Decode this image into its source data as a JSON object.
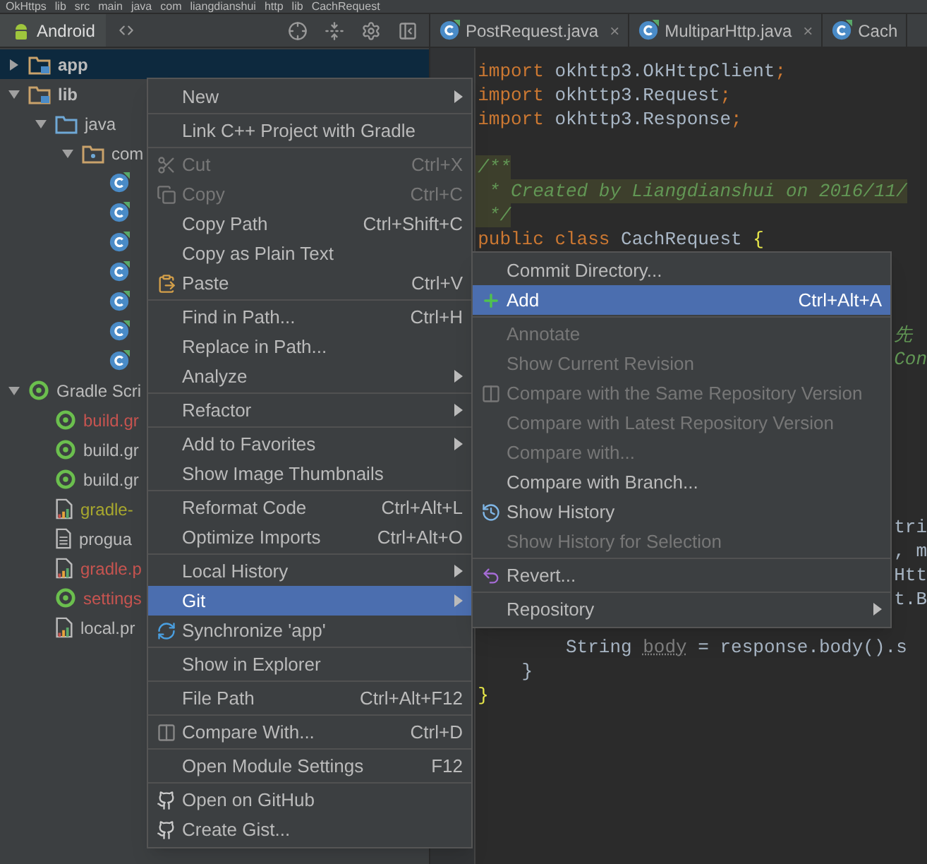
{
  "breadcrumb": [
    {
      "label": "OkHttps"
    },
    {
      "label": "lib"
    },
    {
      "label": "src"
    },
    {
      "label": "main"
    },
    {
      "label": "java"
    },
    {
      "label": "com"
    },
    {
      "label": "liangdianshui"
    },
    {
      "label": "http"
    },
    {
      "label": "lib"
    },
    {
      "label": "CachRequest"
    }
  ],
  "project_panel": {
    "view": "Android",
    "tree": [
      {
        "label": "app",
        "kind": "module",
        "bold": true,
        "selected": true,
        "expanded": false
      },
      {
        "label": "lib",
        "kind": "module",
        "bold": true,
        "selected": false,
        "expanded": true,
        "children": [
          {
            "label": "java",
            "kind": "source",
            "selected": false,
            "expanded": true,
            "children": [
              {
                "label": "com",
                "kind": "package",
                "selected": false,
                "expanded": true,
                "children": [
                  {
                    "kind": "class",
                    "selected": false
                  },
                  {
                    "kind": "class",
                    "selected": false
                  },
                  {
                    "kind": "class",
                    "selected": false
                  },
                  {
                    "kind": "class",
                    "selected": false
                  },
                  {
                    "kind": "class",
                    "selected": false
                  },
                  {
                    "kind": "class",
                    "selected": false
                  },
                  {
                    "kind": "class",
                    "selected": false
                  }
                ]
              }
            ]
          }
        ]
      },
      {
        "label": "Gradle Scri",
        "kind": "gradle",
        "selected": false,
        "expanded": true,
        "children": [
          {
            "label": "build.gr",
            "kind": "gradle",
            "color": "#c75450",
            "selected": false
          },
          {
            "label": "build.gr",
            "kind": "gradle",
            "color": "#bbbbbb",
            "selected": false
          },
          {
            "label": "build.gr",
            "kind": "gradle",
            "color": "#bbbbbb",
            "selected": false
          },
          {
            "label": "gradle-",
            "kind": "properties",
            "color": "#a8a82e",
            "selected": false
          },
          {
            "label": "progua",
            "kind": "text",
            "color": "#bbbbbb",
            "selected": false
          },
          {
            "label": "gradle.p",
            "kind": "properties",
            "color": "#c75450",
            "selected": false
          },
          {
            "label": "settings",
            "kind": "gradle",
            "color": "#c75450",
            "selected": false
          },
          {
            "label": "local.pr",
            "kind": "properties",
            "color": "#bbbbbb",
            "selected": false
          }
        ]
      }
    ]
  },
  "editor_tabs": [
    {
      "label": "PostRequest.java",
      "close": "×"
    },
    {
      "label": "MultiparHttp.java",
      "close": "×"
    },
    {
      "label": "Cach"
    }
  ],
  "code": [
    {
      "kind": "code",
      "segments": [
        {
          "text": "import",
          "kind": "keyword"
        },
        {
          "text": " okhttp3.OkHttpClient",
          "kind": "plain"
        },
        {
          "text": ";",
          "kind": "keyword"
        }
      ]
    },
    {
      "kind": "code",
      "segments": [
        {
          "text": "import",
          "kind": "keyword"
        },
        {
          "text": " okhttp3.Request",
          "kind": "plain"
        },
        {
          "text": ";",
          "kind": "keyword"
        }
      ]
    },
    {
      "kind": "code",
      "segments": [
        {
          "text": "import",
          "kind": "keyword"
        },
        {
          "text": " okhttp3.Response",
          "kind": "plain"
        },
        {
          "text": ";",
          "kind": "keyword"
        }
      ]
    },
    {
      "kind": "blank"
    },
    {
      "kind": "code",
      "doc": true,
      "segments": [
        {
          "text": "/**",
          "kind": "comment"
        }
      ]
    },
    {
      "kind": "code",
      "doc": true,
      "segments": [
        {
          "text": " * Created by Liangdianshui on 2016/11/",
          "kind": "comment"
        }
      ]
    },
    {
      "kind": "code",
      "doc": true,
      "segments": [
        {
          "text": " */",
          "kind": "comment"
        }
      ]
    },
    {
      "kind": "code",
      "segments": [
        {
          "text": "public class",
          "kind": "keyword"
        },
        {
          "text": " CachRequest ",
          "kind": "plain"
        },
        {
          "text": "{",
          "kind": "brace"
        }
      ]
    },
    {
      "kind": "blank"
    },
    {
      "kind": "blank"
    },
    {
      "kind": "blank"
    },
    {
      "kind": "fragment",
      "segments": [
        {
          "text": "先",
          "kind": "comment"
        }
      ]
    },
    {
      "kind": "fragment",
      "segments": [
        {
          "text": "Con",
          "kind": "comment"
        }
      ]
    },
    {
      "kind": "blank"
    },
    {
      "kind": "blank"
    },
    {
      "kind": "blank"
    },
    {
      "kind": "blank"
    },
    {
      "kind": "blank"
    },
    {
      "kind": "blank"
    },
    {
      "kind": "fragment",
      "segments": [
        {
          "text": "tri",
          "kind": "plain"
        }
      ]
    },
    {
      "kind": "fragment",
      "segments": [
        {
          "text": ", m",
          "kind": "plain"
        }
      ]
    },
    {
      "kind": "fragment",
      "segments": [
        {
          "text": "Htt",
          "kind": "plain"
        }
      ]
    },
    {
      "kind": "fragment",
      "segments": [
        {
          "text": "t.B",
          "kind": "plain"
        }
      ]
    },
    {
      "kind": "blank"
    },
    {
      "kind": "code",
      "segments": [
        {
          "text": "        String ",
          "kind": "plain"
        },
        {
          "text": "body",
          "kind": "unused"
        },
        {
          "text": " = response.body().s",
          "kind": "plain"
        }
      ]
    },
    {
      "kind": "code",
      "segments": [
        {
          "text": "    }",
          "kind": "plain"
        }
      ]
    },
    {
      "kind": "code",
      "segments": [
        {
          "text": "}",
          "kind": "brace"
        }
      ]
    }
  ],
  "context_menu": {
    "items": [
      {
        "kind": "item",
        "label": "New",
        "submenu": true,
        "disabled": false,
        "selected": false
      },
      {
        "kind": "separator"
      },
      {
        "kind": "item",
        "label": "Link C++ Project with Gradle",
        "disabled": false,
        "selected": false
      },
      {
        "kind": "separator"
      },
      {
        "kind": "item",
        "label": "Cut",
        "shortcut": "Ctrl+X",
        "disabled": true,
        "selected": false
      },
      {
        "kind": "item",
        "label": "Copy",
        "shortcut": "Ctrl+C",
        "disabled": true,
        "selected": false
      },
      {
        "kind": "item",
        "label": "Copy Path",
        "shortcut": "Ctrl+Shift+C",
        "disabled": false,
        "selected": false
      },
      {
        "kind": "item",
        "label": "Copy as Plain Text",
        "disabled": false,
        "selected": false
      },
      {
        "kind": "item",
        "label": "Paste",
        "shortcut": "Ctrl+V",
        "disabled": false,
        "selected": false
      },
      {
        "kind": "separator"
      },
      {
        "kind": "item",
        "label": "Find in Path...",
        "shortcut": "Ctrl+H",
        "disabled": false,
        "selected": false
      },
      {
        "kind": "item",
        "label": "Replace in Path...",
        "disabled": false,
        "selected": false
      },
      {
        "kind": "item",
        "label": "Analyze",
        "submenu": true,
        "disabled": false,
        "selected": false
      },
      {
        "kind": "separator"
      },
      {
        "kind": "item",
        "label": "Refactor",
        "submenu": true,
        "disabled": false,
        "selected": false
      },
      {
        "kind": "separator"
      },
      {
        "kind": "item",
        "label": "Add to Favorites",
        "submenu": true,
        "disabled": false,
        "selected": false
      },
      {
        "kind": "item",
        "label": "Show Image Thumbnails",
        "disabled": false,
        "selected": false
      },
      {
        "kind": "separator"
      },
      {
        "kind": "item",
        "label": "Reformat Code",
        "shortcut": "Ctrl+Alt+L",
        "disabled": false,
        "selected": false
      },
      {
        "kind": "item",
        "label": "Optimize Imports",
        "shortcut": "Ctrl+Alt+O",
        "disabled": false,
        "selected": false
      },
      {
        "kind": "separator"
      },
      {
        "kind": "item",
        "label": "Local History",
        "submenu": true,
        "disabled": false,
        "selected": false
      },
      {
        "kind": "item",
        "label": "Git",
        "submenu": true,
        "disabled": false,
        "selected": true
      },
      {
        "kind": "item",
        "label": "Synchronize 'app'",
        "disabled": false,
        "selected": false
      },
      {
        "kind": "separator"
      },
      {
        "kind": "item",
        "label": "Show in Explorer",
        "disabled": false,
        "selected": false
      },
      {
        "kind": "separator"
      },
      {
        "kind": "item",
        "label": "File Path",
        "shortcut": "Ctrl+Alt+F12",
        "disabled": false,
        "selected": false
      },
      {
        "kind": "separator"
      },
      {
        "kind": "item",
        "label": "Compare With...",
        "shortcut": "Ctrl+D",
        "disabled": false,
        "selected": false
      },
      {
        "kind": "separator"
      },
      {
        "kind": "item",
        "label": "Open Module Settings",
        "shortcut": "F12",
        "disabled": false,
        "selected": false
      },
      {
        "kind": "separator"
      },
      {
        "kind": "item",
        "label": "Open on GitHub",
        "disabled": false,
        "selected": false
      },
      {
        "kind": "item",
        "label": "Create Gist...",
        "disabled": false,
        "selected": false
      }
    ]
  },
  "git_submenu": {
    "items": [
      {
        "kind": "item",
        "label": "Commit Directory...",
        "disabled": false,
        "selected": false
      },
      {
        "kind": "item",
        "label": "Add",
        "shortcut": "Ctrl+Alt+A",
        "disabled": false,
        "selected": true
      },
      {
        "kind": "separator"
      },
      {
        "kind": "item",
        "label": "Annotate",
        "disabled": true,
        "selected": false
      },
      {
        "kind": "item",
        "label": "Show Current Revision",
        "disabled": true,
        "selected": false
      },
      {
        "kind": "item",
        "label": "Compare with the Same Repository Version",
        "disabled": true,
        "selected": false
      },
      {
        "kind": "item",
        "label": "Compare with Latest Repository Version",
        "disabled": true,
        "selected": false
      },
      {
        "kind": "item",
        "label": "Compare with...",
        "disabled": true,
        "selected": false
      },
      {
        "kind": "item",
        "label": "Compare with Branch...",
        "disabled": false,
        "selected": false
      },
      {
        "kind": "item",
        "label": "Show History",
        "disabled": false,
        "selected": false
      },
      {
        "kind": "item",
        "label": "Show History for Selection",
        "disabled": true,
        "selected": false
      },
      {
        "kind": "separator"
      },
      {
        "kind": "item",
        "label": "Revert...",
        "disabled": false,
        "selected": false
      },
      {
        "kind": "separator"
      },
      {
        "kind": "item",
        "label": "Repository",
        "submenu": true,
        "disabled": false,
        "selected": false
      }
    ]
  }
}
